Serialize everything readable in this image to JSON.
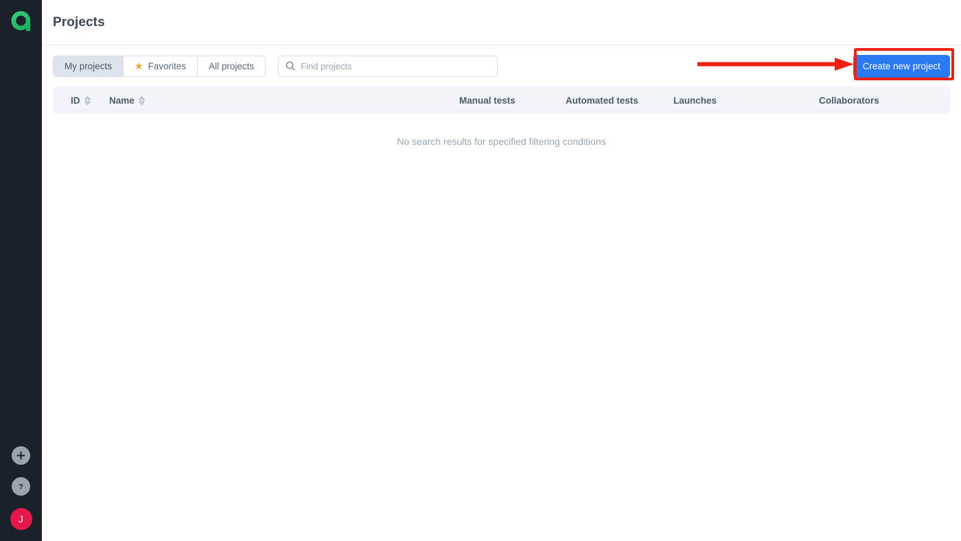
{
  "sidebar": {
    "logo": {
      "name": "allure-logo",
      "color": "#2dbd6e"
    },
    "bottom_items": [
      {
        "name": "add-button",
        "icon": "plus-icon",
        "label": "+"
      },
      {
        "name": "help-button",
        "icon": "question-mark-icon",
        "label": "?"
      }
    ],
    "avatar": {
      "initial": "J",
      "color": "#e8174a"
    }
  },
  "header": {
    "title": "Projects"
  },
  "toolbar": {
    "tabs": [
      {
        "label": "My projects",
        "active": true,
        "icon": null
      },
      {
        "label": "Favorites",
        "active": false,
        "icon": "star-icon"
      },
      {
        "label": "All projects",
        "active": false,
        "icon": null
      }
    ],
    "search": {
      "placeholder": "Find projects",
      "value": "",
      "icon": "search-icon"
    },
    "create_button": {
      "label": "Create new project",
      "color": "#2979f2"
    }
  },
  "table": {
    "columns": [
      {
        "label": "ID",
        "sortable": true
      },
      {
        "label": "Name",
        "sortable": true
      },
      {
        "label": "Manual tests",
        "sortable": false
      },
      {
        "label": "Automated tests",
        "sortable": false
      },
      {
        "label": "Launches",
        "sortable": false
      },
      {
        "label": "Collaborators",
        "sortable": false
      }
    ],
    "rows": [],
    "empty_message": "No search results for specified filtering conditions"
  },
  "annotations": {
    "color": "#ef2010",
    "arrow": {
      "name": "red-pointer-arrow",
      "direction": "right"
    },
    "highlight_box": {
      "name": "red-highlight-box",
      "target": "create-new-project-button"
    }
  }
}
